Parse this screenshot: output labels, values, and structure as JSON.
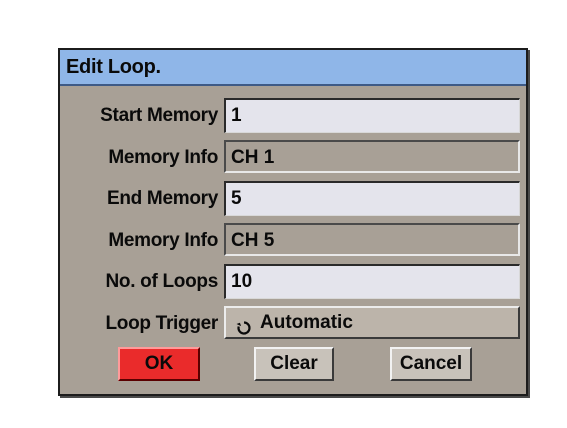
{
  "dialog": {
    "title": "Edit Loop."
  },
  "fields": {
    "start_memory": {
      "label": "Start Memory",
      "value": "1"
    },
    "memory_info_1": {
      "label": "Memory Info",
      "value": "CH 1"
    },
    "end_memory": {
      "label": "End Memory",
      "value": "5"
    },
    "memory_info_2": {
      "label": "Memory Info",
      "value": "CH 5"
    },
    "num_loops": {
      "label": "No. of Loops",
      "value": "10"
    },
    "loop_trigger": {
      "label": "Loop Trigger",
      "value": "Automatic",
      "icon": "refresh-icon"
    }
  },
  "buttons": {
    "ok": "OK",
    "clear": "Clear",
    "cancel": "Cancel"
  },
  "colors": {
    "dialog_bg": "#a8a096",
    "title_bg": "#8fb6e8",
    "ok_bg": "#ea2b2b",
    "input_bg": "#e4e4ec"
  }
}
